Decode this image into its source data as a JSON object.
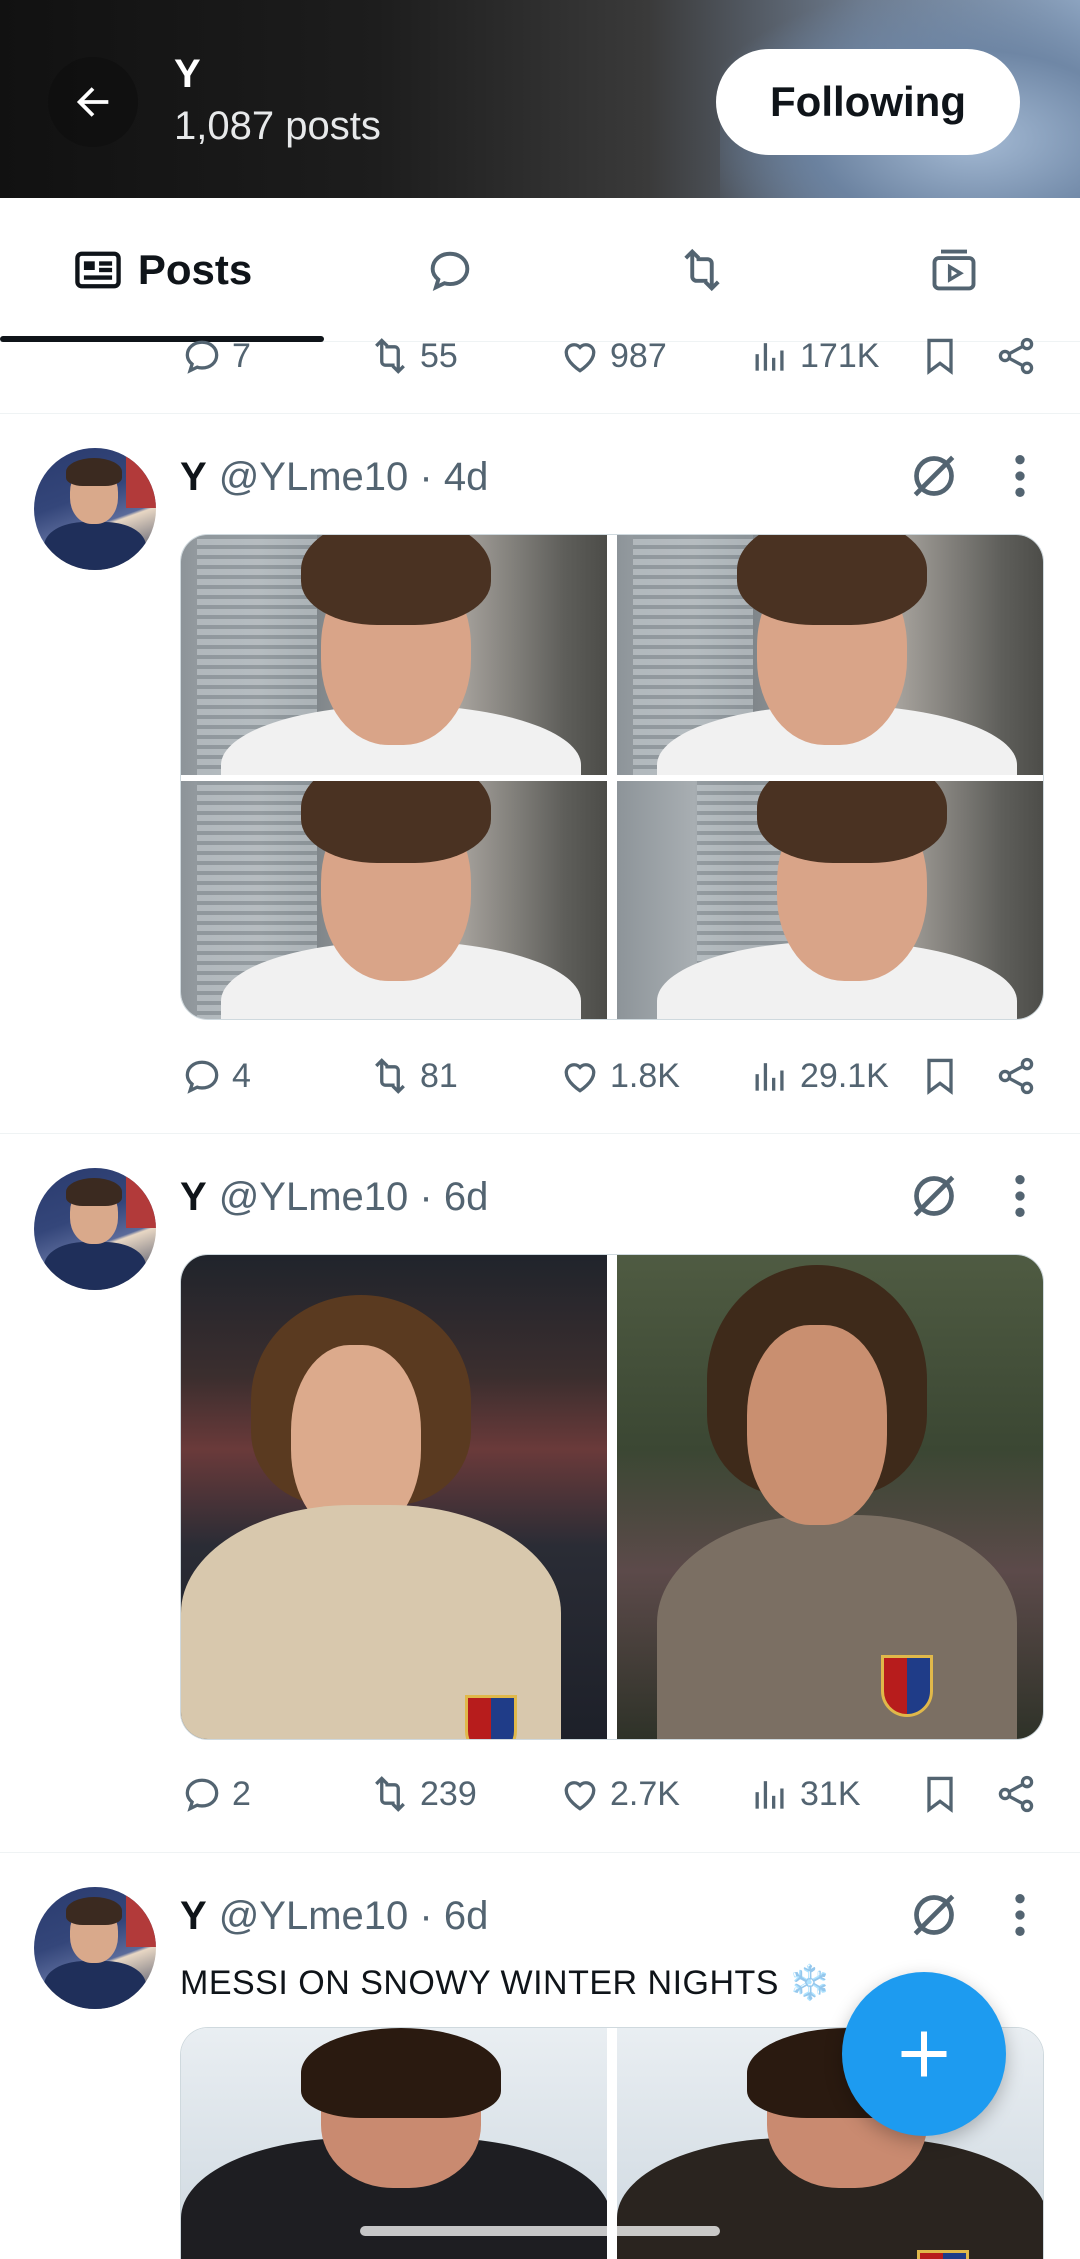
{
  "header": {
    "title": "Y",
    "subtitle": "1,087 posts",
    "follow_label": "Following"
  },
  "tabs": [
    {
      "label": "Posts",
      "icon": "article-icon",
      "active": true
    },
    {
      "icon": "reply-bubble-icon"
    },
    {
      "icon": "repost-icon"
    },
    {
      "icon": "video-icon"
    }
  ],
  "partial_post": {
    "replies": "7",
    "reposts": "55",
    "likes": "987",
    "views": "171K"
  },
  "posts": [
    {
      "name": "Y",
      "meta": "@YLme10 · 4d",
      "replies": "4",
      "reposts": "81",
      "likes": "1.8K",
      "views": "29.1K"
    },
    {
      "name": "Y",
      "meta": "@YLme10 · 6d",
      "replies": "2",
      "reposts": "239",
      "likes": "2.7K",
      "views": "31K"
    },
    {
      "name": "Y",
      "meta": "@YLme10 · 6d",
      "caption": "MESSI ON SNOWY WINTER NIGHTS ❄️"
    }
  ],
  "colors": {
    "accent": "#1d9bf0",
    "text": "#0f1419",
    "muted": "#536471"
  }
}
